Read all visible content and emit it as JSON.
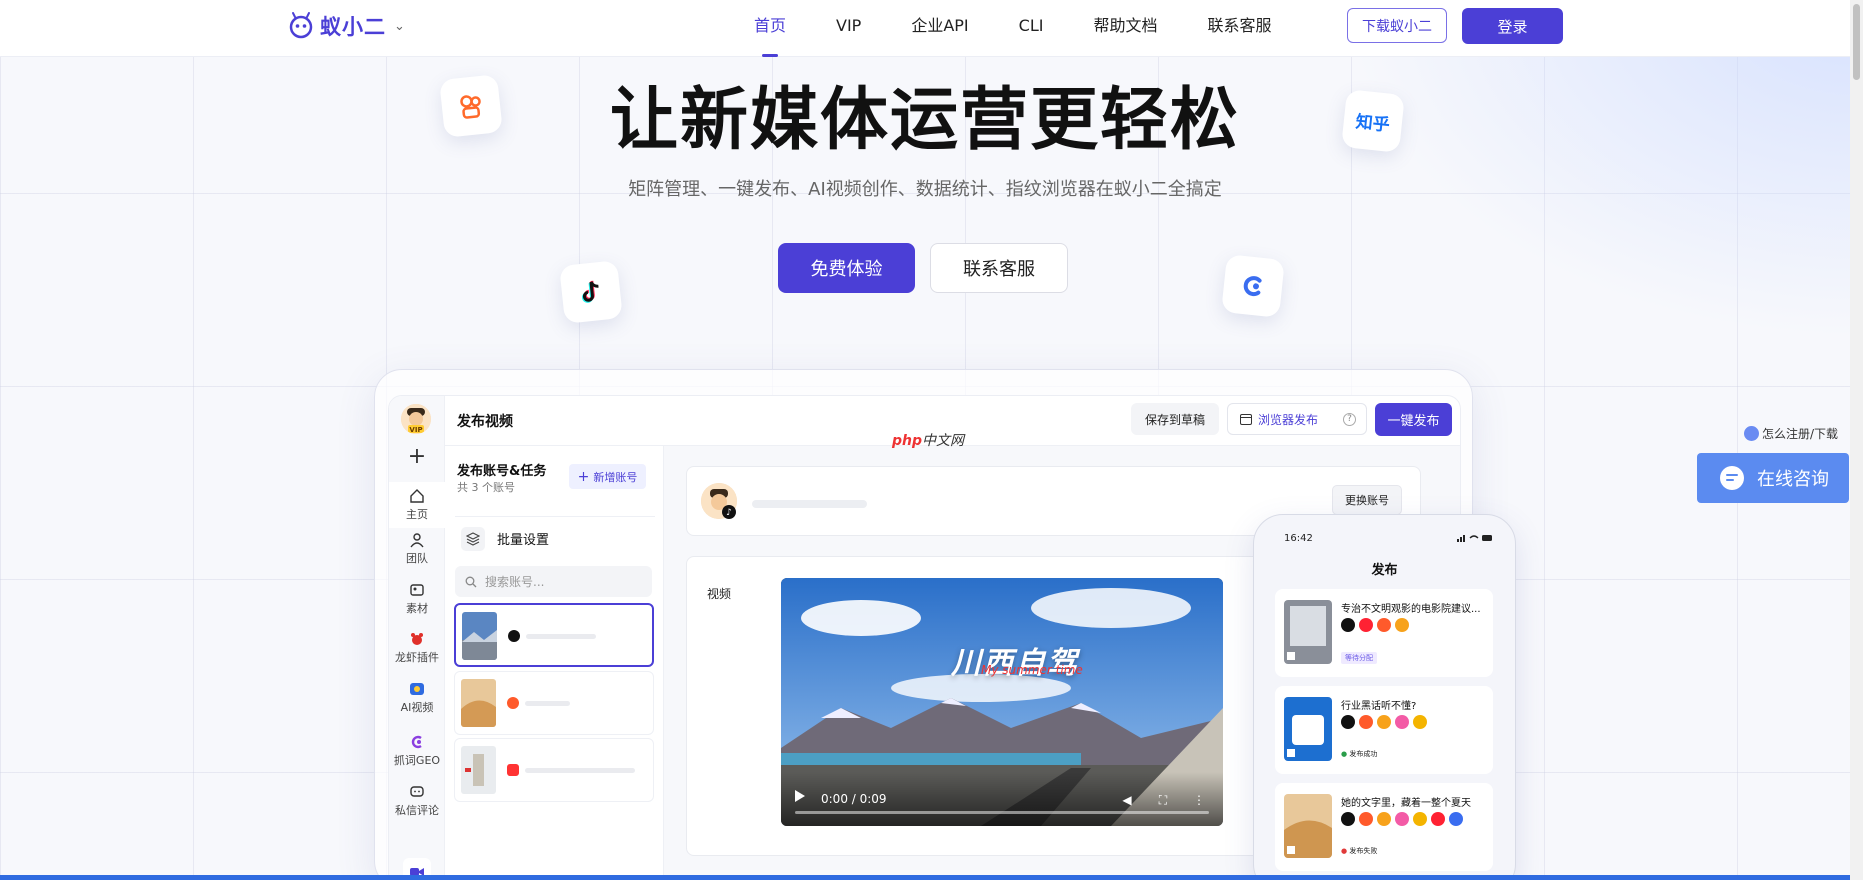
{
  "header": {
    "logo_text": "蚁小二",
    "nav": [
      "首页",
      "VIP",
      "企业API",
      "CLI",
      "帮助文档",
      "联系客服"
    ],
    "active_nav": "首页",
    "download_label": "下载蚁小二",
    "login_label": "登录"
  },
  "hero": {
    "title": "让新媒体运营更轻松",
    "subtitle": "矩阵管理、一键发布、AI视频创作、数据统计、指纹浏览器在蚁小二全搞定",
    "primary_cta": "免费体验",
    "secondary_cta": "联系客服",
    "float_icons": [
      "kuaishou-icon",
      "zhihu-icon",
      "douyin-icon",
      "c-logo-icon"
    ],
    "zhihu_text": "知乎"
  },
  "app": {
    "rail": {
      "vip_badge": "VIP",
      "items": [
        {
          "label": "主页",
          "icon": "home-icon"
        },
        {
          "label": "团队",
          "icon": "team-icon"
        },
        {
          "label": "素材",
          "icon": "material-icon"
        },
        {
          "label": "龙虾插件",
          "icon": "lobster-icon"
        },
        {
          "label": "AI视频",
          "icon": "ai-video-icon"
        },
        {
          "label": "抓词GEO",
          "icon": "geo-icon"
        },
        {
          "label": "私信评论",
          "icon": "message-icon"
        }
      ]
    },
    "topbar": {
      "title": "发布视频",
      "save_draft": "保存到草稿",
      "browser_publish": "浏览器发布",
      "publish": "一键发布"
    },
    "accounts": {
      "title": "发布账号&任务",
      "count": "共 3 个账号",
      "add_label": "新增账号",
      "batch_label": "批量设置",
      "search_placeholder": "搜索账号..."
    },
    "content": {
      "switch_account": "更换账号",
      "video_label": "视频",
      "video_overlay_title": "川西自驾",
      "video_overlay_script": "My summer time",
      "video_time": "0:00 / 0:09"
    }
  },
  "watermark": {
    "prefix": "php",
    "suffix": "中文网"
  },
  "phone": {
    "time": "16:42",
    "title": "发布",
    "cards": [
      {
        "title": "专治不文明观影的电影院建议...",
        "status": "等待分配",
        "status_color": "#6c5ce7"
      },
      {
        "title": "行业黑话听不懂?",
        "status": "发布成功",
        "status_color": "#2a9d4a"
      },
      {
        "title": "她的文字里，藏着一整个夏天",
        "status": "发布失败",
        "status_color": "#e03a3a"
      }
    ]
  },
  "widgets": {
    "help_link": "怎么注册/下载",
    "chat_label": "在线咨询"
  },
  "colors": {
    "brand": "#4b3fd6",
    "chat": "#5b8bf0"
  }
}
